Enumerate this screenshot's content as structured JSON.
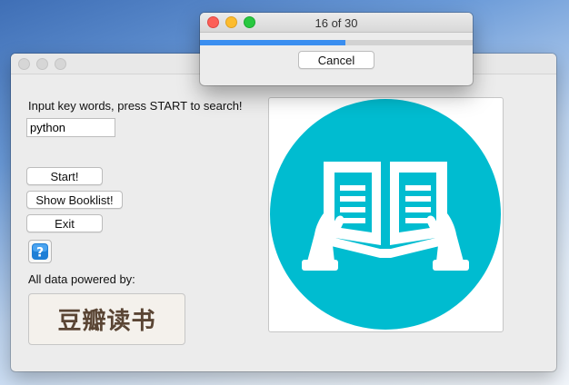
{
  "progress_dialog": {
    "title": "16 of 30",
    "progress_current": 16,
    "progress_total": 30,
    "cancel_label": "Cancel",
    "accent_color": "#3a8ef0"
  },
  "main": {
    "prompt_label": "Input key words, press START to search!",
    "keyword_value": "python",
    "start_label": "Start!",
    "booklist_label": "Show Booklist!",
    "exit_label": "Exit",
    "help_icon": "question-icon",
    "powered_label": "All data powered by:",
    "logo_text": "豆瓣读书",
    "image_icon": "reading-book-icon",
    "image_color": "#00bcd0"
  }
}
